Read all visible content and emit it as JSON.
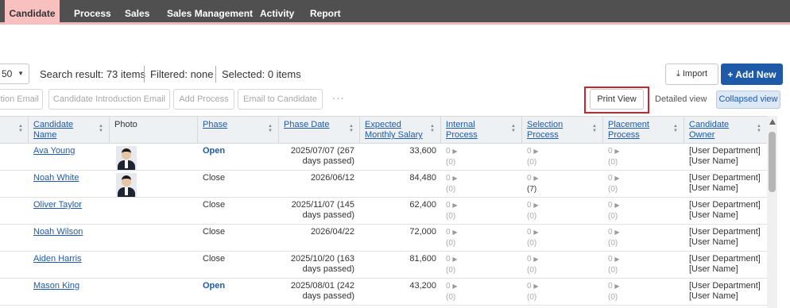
{
  "nav": {
    "tabs": [
      "Candidate",
      "Process",
      "Sales",
      "Sales Management",
      "Activity",
      "Report"
    ]
  },
  "toolbar": {
    "per_page": "50",
    "search_result": "Search result: 73 items",
    "filtered": "Filtered: none",
    "selected": "Selected:  0 items",
    "import_label": "Import",
    "add_new_label": "+ Add New",
    "actions": [
      "ction Email",
      "Candidate Introduction Email",
      "Add Process",
      "Email to Candidate"
    ],
    "more_label": "···",
    "print_view_label": "Print View",
    "detailed_view_label": "Detailed view",
    "collapsed_view_label": "Collapsed view"
  },
  "grid": {
    "headers": {
      "candidate_name": [
        "Candidate",
        "Name"
      ],
      "photo": "Photo",
      "phase": "Phase",
      "phase_date": "Phase Date",
      "salary": [
        "Expected",
        "Monthly Salary"
      ],
      "internal": [
        "Internal",
        "Process"
      ],
      "selection": [
        "Selection",
        "Process"
      ],
      "placement": [
        "Placement",
        "Process"
      ],
      "owner": [
        "Candidate",
        "Owner"
      ]
    },
    "rows": [
      {
        "name": "Ava Young",
        "photo": "female",
        "phase": "Open",
        "date": [
          "2025/07/07 (267",
          "days passed)"
        ],
        "salary": "33,600",
        "internal": [
          "0",
          "(0)"
        ],
        "selection": [
          "0",
          "(0)"
        ],
        "placement": [
          "0",
          "(0)"
        ],
        "owner": [
          "[User Department]",
          "[User Name]"
        ]
      },
      {
        "name": "Noah White",
        "photo": "male",
        "phase": "Close",
        "date": [
          "2026/06/12",
          ""
        ],
        "salary": "84,480",
        "internal": [
          "0",
          "(0)"
        ],
        "selection": [
          "0",
          "(7)"
        ],
        "placement": [
          "0",
          "(0)"
        ],
        "owner": [
          "[User Department]",
          "[User Name]"
        ]
      },
      {
        "name": "Oliver Taylor",
        "photo": "",
        "phase": "Close",
        "date": [
          "2025/11/07 (145",
          "days passed)"
        ],
        "salary": "62,400",
        "internal": [
          "0",
          "(0)"
        ],
        "selection": [
          "0",
          "(0)"
        ],
        "placement": [
          "0",
          "(0)"
        ],
        "owner": [
          "[User Department]",
          "[User Name]"
        ]
      },
      {
        "name": "Noah Wilson",
        "photo": "",
        "phase": "Close",
        "date": [
          "2026/04/22",
          ""
        ],
        "salary": "72,000",
        "internal": [
          "0",
          "(0)"
        ],
        "selection": [
          "0",
          "(0)"
        ],
        "placement": [
          "0",
          "(0)"
        ],
        "owner": [
          "[User Department]",
          "[User Name]"
        ]
      },
      {
        "name": "Aiden Harris",
        "photo": "",
        "phase": "Close",
        "date": [
          "2025/10/20 (163",
          "days passed)"
        ],
        "salary": "81,600",
        "internal": [
          "0",
          "(0)"
        ],
        "selection": [
          "0",
          "(0)"
        ],
        "placement": [
          "0",
          "(0)"
        ],
        "owner": [
          "[User Department]",
          "[User Name]"
        ]
      },
      {
        "name": "Mason King",
        "photo": "",
        "phase": "Open",
        "date": [
          "2025/08/01 (242",
          "days passed)"
        ],
        "salary": "43,200",
        "internal": [
          "0",
          "(0)"
        ],
        "selection": [
          "0",
          "(0)"
        ],
        "placement": [
          "0",
          "(0)"
        ],
        "owner": [
          "[User Department]",
          "[User Name]"
        ]
      }
    ]
  }
}
